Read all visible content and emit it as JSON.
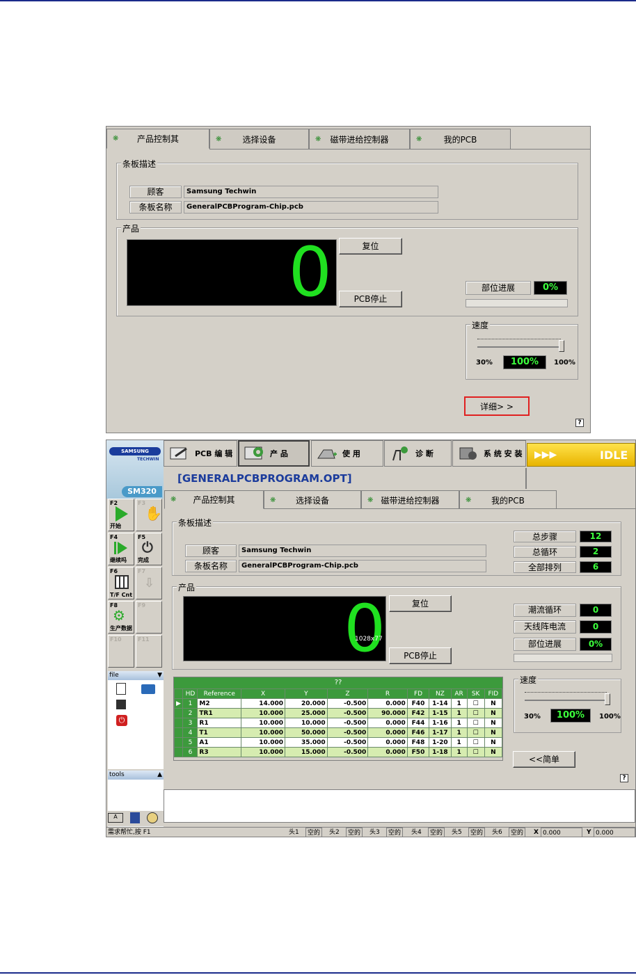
{
  "top_dialog": {
    "tabs": [
      {
        "label": "产品控制其"
      },
      {
        "label": "选择设备"
      },
      {
        "label": "磁带进给控制器"
      },
      {
        "label": "我的PCB"
      }
    ],
    "board_desc_legend": "条板描述",
    "customer_label": "顾客",
    "customer_value": "Samsung Techwin",
    "board_name_label": "条板名称",
    "board_name_value": "GeneralPCBProgram-Chip.pcb",
    "product_legend": "产品",
    "counter": "0",
    "reset_button": "复位",
    "pcb_stop_button": "PCB停止",
    "part_progress_label": "部位进展",
    "part_progress_value": "0%",
    "speed_legend": "速度",
    "speed_min": "30%",
    "speed_value": "100%",
    "speed_max": "100%",
    "speed_level": 1.0,
    "details_button": "详细> >",
    "help": "?"
  },
  "main_window": {
    "brand_top": "SAMSUNG",
    "brand_sub": "TECHWIN",
    "model": "SM320",
    "toolbar": [
      {
        "label": "PCB 编 辑",
        "icon": "pcb-edit-icon"
      },
      {
        "label": "产 品",
        "icon": "product-icon"
      },
      {
        "label": "使 用",
        "icon": "use-icon"
      },
      {
        "label": "诊 断",
        "icon": "diagnose-icon"
      },
      {
        "label": "系 统 安 装",
        "icon": "system-setup-icon"
      }
    ],
    "status_arrows": "▶▶▶",
    "status_text": "IDLE",
    "program_title": "[GENERALPCBPROGRAM.OPT]",
    "fkeys": [
      {
        "key": "F2",
        "label": "开始",
        "enabled": true
      },
      {
        "key": "F3",
        "label": "",
        "enabled": false
      },
      {
        "key": "F4",
        "label": "继续吗",
        "enabled": true
      },
      {
        "key": "F5",
        "label": "完成",
        "enabled": true
      },
      {
        "key": "F6",
        "label": "T/F Cnt",
        "enabled": true
      },
      {
        "key": "F7",
        "label": "",
        "enabled": false
      },
      {
        "key": "F8",
        "label": "生产数据",
        "enabled": true
      },
      {
        "key": "F9",
        "label": "",
        "enabled": false
      },
      {
        "key": "F10",
        "label": "",
        "enabled": false
      },
      {
        "key": "F11",
        "label": "",
        "enabled": false
      }
    ],
    "file_section": "file",
    "tools_section": "tools",
    "tabs": [
      {
        "label": "产品控制其"
      },
      {
        "label": "选择设备"
      },
      {
        "label": "磁带进给控制器"
      },
      {
        "label": "我的PCB"
      }
    ],
    "board_desc_legend": "条板描述",
    "customer_label": "顾客",
    "customer_value": "Samsung Techwin",
    "board_name_label": "条板名称",
    "board_name_value": "GeneralPCBProgram-Chip.pcb",
    "total_steps_label": "总步骤",
    "total_steps_value": "12",
    "total_cycles_label": "总循环",
    "total_cycles_value": "2",
    "all_arrays_label": "全部排列",
    "all_arrays_value": "6",
    "product_legend": "产品",
    "counter": "0",
    "counter_overlay": "1028x77",
    "reset_button": "复位",
    "pcb_stop_button": "PCB停止",
    "tide_cycle_label": "潮流循环",
    "tide_cycle_value": "0",
    "antenna_label": "天线阵电流",
    "antenna_value": "0",
    "part_progress_label": "部位进展",
    "part_progress_value": "0%",
    "table": {
      "title": "??",
      "headers": [
        "HD",
        "Reference",
        "X",
        "Y",
        "Z",
        "R",
        "FD",
        "NZ",
        "AR",
        "SK",
        "FID"
      ],
      "rows": [
        [
          "1",
          "M2",
          "14.000",
          "20.000",
          "-0.500",
          "0.000",
          "F40",
          "1-14",
          "1",
          "☐",
          "N"
        ],
        [
          "2",
          "TR1",
          "10.000",
          "25.000",
          "-0.500",
          "90.000",
          "F42",
          "1-15",
          "1",
          "☐",
          "N"
        ],
        [
          "3",
          "R1",
          "10.000",
          "10.000",
          "-0.500",
          "0.000",
          "F44",
          "1-16",
          "1",
          "☐",
          "N"
        ],
        [
          "4",
          "T1",
          "10.000",
          "50.000",
          "-0.500",
          "0.000",
          "F46",
          "1-17",
          "1",
          "☐",
          "N"
        ],
        [
          "5",
          "A1",
          "10.000",
          "35.000",
          "-0.500",
          "0.000",
          "F48",
          "1-20",
          "1",
          "☐",
          "N"
        ],
        [
          "6",
          "R3",
          "10.000",
          "15.000",
          "-0.500",
          "0.000",
          "F50",
          "1-18",
          "1",
          "☐",
          "N"
        ]
      ]
    },
    "speed_legend": "速度",
    "speed_min": "30%",
    "speed_value": "100%",
    "speed_max": "100%",
    "speed_level": 1.0,
    "simple_button": "<<简单",
    "help": "?",
    "statusbar": {
      "hint": "需求帮忙,按 F1",
      "heads": [
        {
          "label": "头1",
          "value": "空的"
        },
        {
          "label": "头2",
          "value": "空的"
        },
        {
          "label": "头3",
          "value": "空的"
        },
        {
          "label": "头4",
          "value": "空的"
        },
        {
          "label": "头5",
          "value": "空的"
        },
        {
          "label": "头6",
          "value": "空的"
        }
      ],
      "x_label": "X",
      "x_value": "0.000",
      "y_label": "Y",
      "y_value": "0.000"
    },
    "colors": {
      "accent_green": "#3c9a3c",
      "idle_yellow": "#f4c400",
      "title_blue": "#1c3c9c"
    }
  }
}
